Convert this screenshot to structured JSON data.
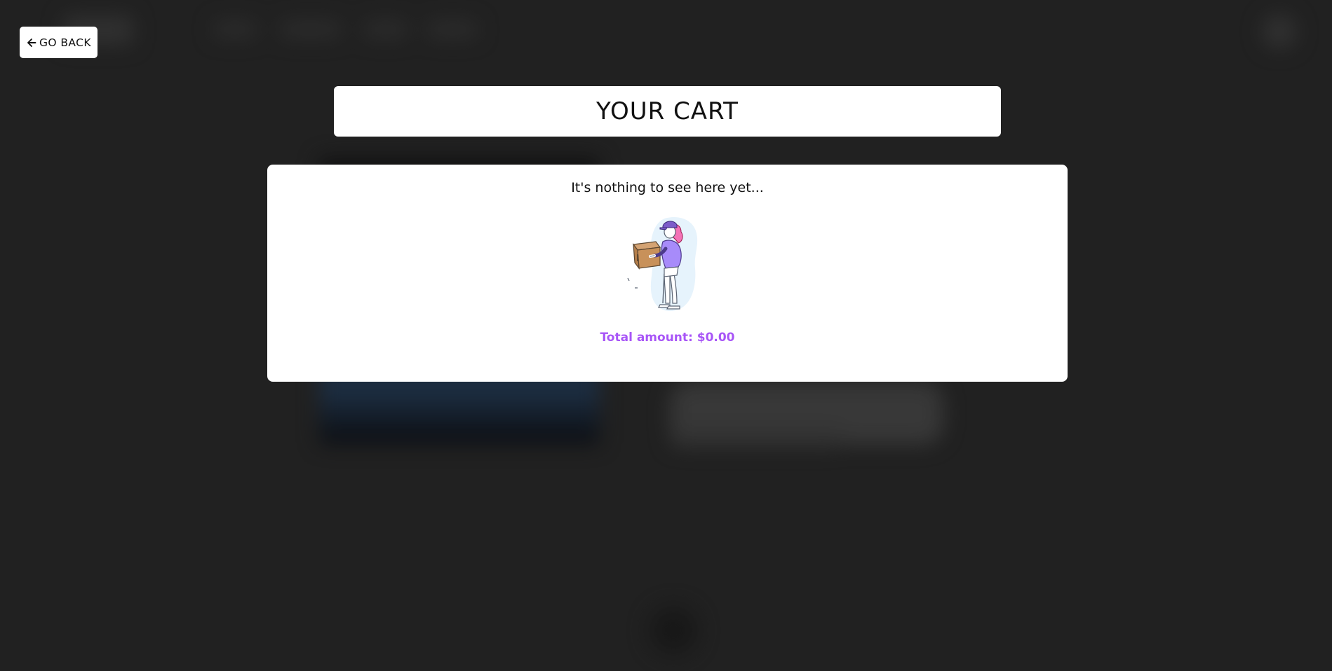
{
  "nav": {
    "go_back_label": "GO BACK",
    "go_back_icon": "arrow-left-icon"
  },
  "cart": {
    "title": "YOUR CART",
    "empty_message": "It's nothing to see here yet...",
    "illustration": "person-holding-box-illustration",
    "total_label": "Total amount: $0.00"
  },
  "colors": {
    "page_background": "#333333",
    "panel_background": "#ffffff",
    "total_accent": "#a855f7"
  }
}
